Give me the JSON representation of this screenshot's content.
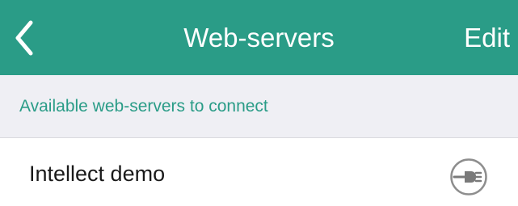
{
  "navbar": {
    "back_icon": "chevron-left-icon",
    "title": "Web-servers",
    "edit_label": "Edit",
    "color": "#2a9c87"
  },
  "section": {
    "header": "Available web-servers to connect",
    "header_color": "#2a9c87",
    "background": "#efeff4"
  },
  "servers": [
    {
      "name": "Intellect demo",
      "action_icon": "plug-connect-icon"
    }
  ]
}
